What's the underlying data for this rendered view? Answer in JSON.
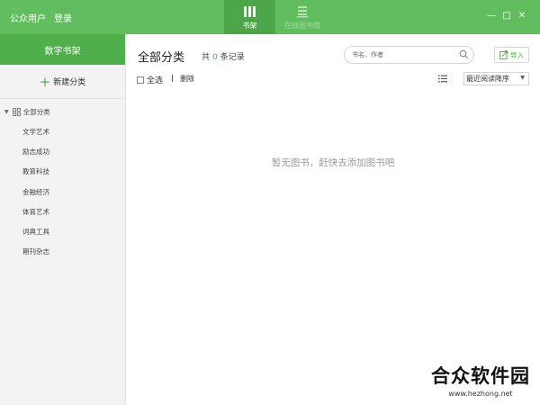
{
  "titlebar": {
    "user_label": "公众用户",
    "login_label": "登录",
    "tabs": [
      {
        "label": "书架",
        "icon": "bookshelf-icon"
      },
      {
        "label": "在线图书馆",
        "icon": "library-icon"
      }
    ],
    "controls": {
      "minimize": "—",
      "maximize": "□",
      "close": "✕"
    }
  },
  "sidebar": {
    "header": "数字书架",
    "new_category_label": "新建分类",
    "all_category_label": "全部分类",
    "categories": [
      {
        "label": "文学艺术"
      },
      {
        "label": "励志成功"
      },
      {
        "label": "教育科技"
      },
      {
        "label": "金融经济"
      },
      {
        "label": "体育艺术"
      },
      {
        "label": "词典工具"
      },
      {
        "label": "期刊杂志"
      }
    ]
  },
  "main": {
    "title": "全部分类",
    "record_prefix": "共",
    "record_count": "0",
    "record_suffix": "条记录",
    "search_placeholder": "书名、作者",
    "import_label": "导入",
    "select_all_label": "全选",
    "delete_label": "删除",
    "sort_selected": "最近阅读降序",
    "empty_message": "暂无图书，赶快去添加图书吧"
  },
  "watermark": {
    "brand": "合众软件园",
    "url": "www.hezhong.net"
  },
  "colors": {
    "brand_green": "#62bd5e",
    "active_green": "#4fb04b"
  }
}
